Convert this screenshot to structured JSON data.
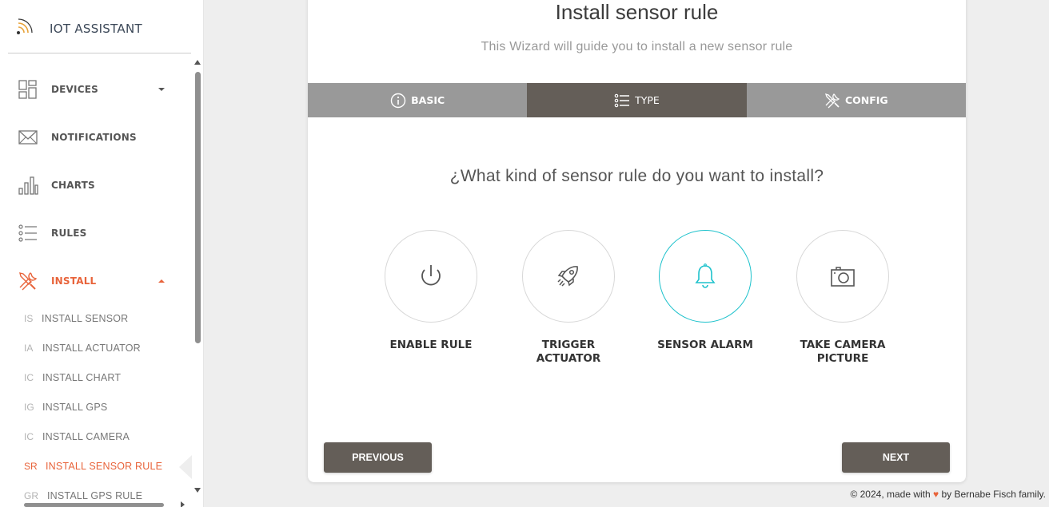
{
  "sidebar": {
    "brand": "IOT ASSISTANT",
    "items": [
      {
        "label": "DEVICES",
        "icon": "devices-grid-icon"
      },
      {
        "label": "NOTIFICATIONS",
        "icon": "envelope-icon"
      },
      {
        "label": "CHARTS",
        "icon": "bar-chart-icon"
      },
      {
        "label": "RULES",
        "icon": "list-icon"
      },
      {
        "label": "INSTALL",
        "icon": "tools-icon"
      }
    ],
    "subitems": [
      {
        "abbr": "IS",
        "label": "INSTALL SENSOR"
      },
      {
        "abbr": "IA",
        "label": "INSTALL ACTUATOR"
      },
      {
        "abbr": "IC",
        "label": "INSTALL CHART"
      },
      {
        "abbr": "IG",
        "label": "INSTALL GPS"
      },
      {
        "abbr": "IC",
        "label": "INSTALL CAMERA"
      },
      {
        "abbr": "SR",
        "label": "INSTALL SENSOR RULE"
      },
      {
        "abbr": "GR",
        "label": "INSTALL GPS RULE"
      }
    ]
  },
  "wizard": {
    "title": "Install sensor rule",
    "subtitle": "This Wizard will guide you to install a new sensor rule",
    "tabs": [
      {
        "label": "BASIC",
        "icon": "info-icon"
      },
      {
        "label": "TYPE",
        "icon": "list-icon"
      },
      {
        "label": "CONFIG",
        "icon": "tools-icon"
      }
    ],
    "active_tab": "TYPE",
    "question": "¿What kind of sensor rule do you want to install?",
    "choices": [
      {
        "line1": "ENABLE RULE",
        "line2": "",
        "icon": "power-icon"
      },
      {
        "line1": "TRIGGER",
        "line2": "ACTUATOR",
        "icon": "rocket-icon"
      },
      {
        "line1": "SENSOR ALARM",
        "line2": "",
        "icon": "bell-icon"
      },
      {
        "line1": "TAKE CAMERA",
        "line2": "PICTURE",
        "icon": "camera-icon"
      }
    ],
    "selected_choice": "SENSOR ALARM",
    "previous_label": "PREVIOUS",
    "next_label": "NEXT"
  },
  "footer": {
    "prefix": "© 2024, made with",
    "heart": "♥",
    "suffix": "by Bernabe Fisch family."
  },
  "colors": {
    "accent": "#e8633a",
    "tab_active": "#645e58",
    "tab_bg": "#999999",
    "selected_ring": "#1ec2cc"
  }
}
